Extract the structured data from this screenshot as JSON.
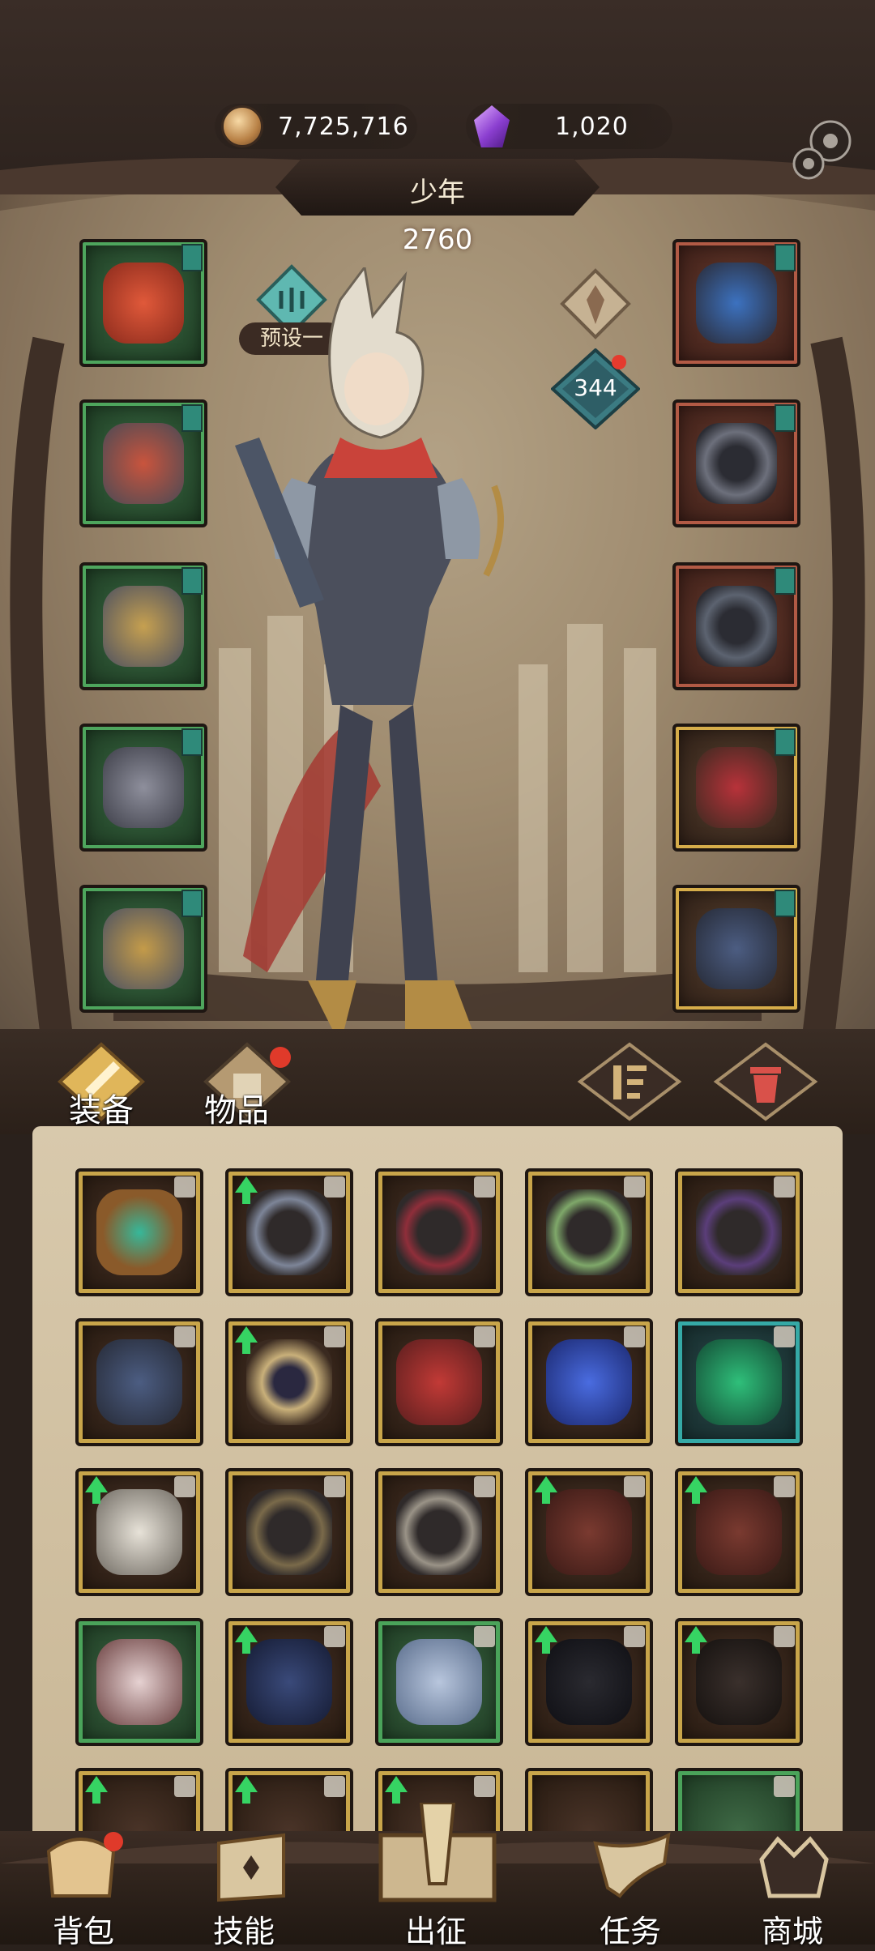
{
  "currency": {
    "gold": "7,725,716",
    "gems": "1,020",
    "gold_icon": "coin-icon",
    "gem_icon": "crystal-icon"
  },
  "hero": {
    "name": "少年",
    "power": "2760",
    "preset_label": "预设一",
    "level_badge": "344"
  },
  "tabs": {
    "equipment": "装备",
    "items": "物品"
  },
  "nav": {
    "backpack": "背包",
    "skills": "技能",
    "expedition": "出征",
    "quests": "任务",
    "shop": "商城"
  },
  "colors": {
    "common_green": "#4ea55d",
    "rare_gold": "#d6ad4a",
    "epic_red": "#b25a45",
    "teal": "#35a9a6",
    "notify_red": "#e03a2a"
  }
}
